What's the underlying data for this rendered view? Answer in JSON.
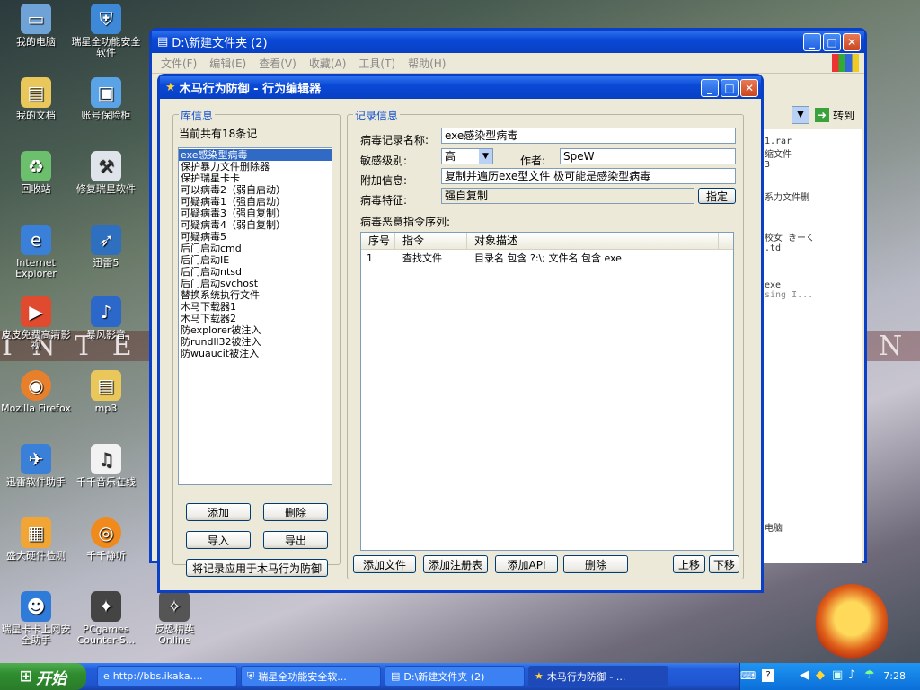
{
  "desktop_icons": [
    {
      "label": "我的电脑",
      "icon": "computer-icon"
    },
    {
      "label": "瑞星全功能安全软件",
      "icon": "shield-icon"
    },
    {
      "label": "我的文档",
      "icon": "folder-icon"
    },
    {
      "label": "账号保险柜",
      "icon": "box-icon"
    },
    {
      "label": "回收站",
      "icon": "recycle-icon"
    },
    {
      "label": "修复瑞星软件",
      "icon": "tool-icon"
    },
    {
      "label": "Internet Explorer",
      "icon": "ie-icon"
    },
    {
      "label": "迅雷5",
      "icon": "thunder-icon"
    },
    {
      "label": "皮皮免费高清影视",
      "icon": "video-icon"
    },
    {
      "label": "暴风影音",
      "icon": "media-icon"
    },
    {
      "label": "Mozilla Firefox",
      "icon": "firefox-icon"
    },
    {
      "label": "mp3",
      "icon": "folder-icon"
    },
    {
      "label": "迅雷软件助手",
      "icon": "assist-icon"
    },
    {
      "label": "千千音乐在线",
      "icon": "music-icon"
    },
    {
      "label": "盛大硬件检测",
      "icon": "hw-icon"
    },
    {
      "label": "千千静听",
      "icon": "player-icon"
    },
    {
      "label": "瑞星卡卡上网安全助手",
      "icon": "kaka-icon"
    },
    {
      "label": "PCgames Counter-S...",
      "icon": "cs-icon"
    },
    {
      "label": "反恐精英 Online",
      "icon": "cso-icon"
    }
  ],
  "explorer": {
    "title": "D:\\新建文件夹 (2)",
    "menu": [
      "文件(F)",
      "编辑(E)",
      "查看(V)",
      "收藏(A)",
      "工具(T)",
      "帮助(H)"
    ],
    "goto": "转到",
    "right_texts": [
      "1.rar",
      "缩文件",
      "3",
      "系力文件删",
      "校女 きーく",
      ".td",
      "exe",
      "sing I...",
      "电脑"
    ]
  },
  "editor": {
    "title": "木马行为防御 - 行为编辑器",
    "lib_group": "库信息",
    "lib_count": "当前共有18条记",
    "items": [
      "exe感染型病毒",
      "保护暴力文件删除器",
      "保护瑞星卡卡",
      "可以病毒2（弱自启动）",
      "可疑病毒1（强自启动）",
      "可疑病毒3（强自复制）",
      "可疑病毒4（弱自复制）",
      "可疑病毒5",
      "后门启动cmd",
      "后门启动IE",
      "后门启动ntsd",
      "后门启动svchost",
      "替换系统执行文件",
      "木马下载器1",
      "木马下载器2",
      "防explorer被注入",
      "防rundll32被注入",
      "防wuaucit被注入"
    ],
    "selected_index": 0,
    "btn_add": "添加",
    "btn_delete": "删除",
    "btn_import": "导入",
    "btn_export": "导出",
    "btn_apply": "将记录应用于木马行为防御",
    "rec_group": "记录信息",
    "name_label": "病毒记录名称:",
    "name_value": "exe感染型病毒",
    "level_label": "敏感级别:",
    "level_value": "高",
    "author_label": "作者:",
    "author_value": "SpeW",
    "extra_label": "附加信息:",
    "extra_value": "复制并遍历exe型文件  极可能是感染型病毒",
    "feature_label": "病毒特征:",
    "feature_value": "强自复制",
    "btn_assign": "指定",
    "seq_label": "病毒恶意指令序列:",
    "col_no": "序号",
    "col_cmd": "指令",
    "col_desc": "对象描述",
    "rows": [
      {
        "no": "1",
        "cmd": "查找文件",
        "desc": "目录名 包含 ?:\\; 文件名 包含 exe"
      }
    ],
    "btn_add_file": "添加文件",
    "btn_add_reg": "添加注册表",
    "btn_add_api": "添加API",
    "btn_del_cmd": "删除",
    "btn_up": "上移",
    "btn_down": "下移"
  },
  "taskbar": {
    "start": "开始",
    "tasks": [
      "http://bbs.ikaka....",
      "瑞星全功能安全软...",
      "D:\\新建文件夹 (2)",
      "木马行为防御 - ..."
    ],
    "clock": "7:28"
  },
  "wallpaper_text": "I N T E",
  "wallpaper_right": "N"
}
